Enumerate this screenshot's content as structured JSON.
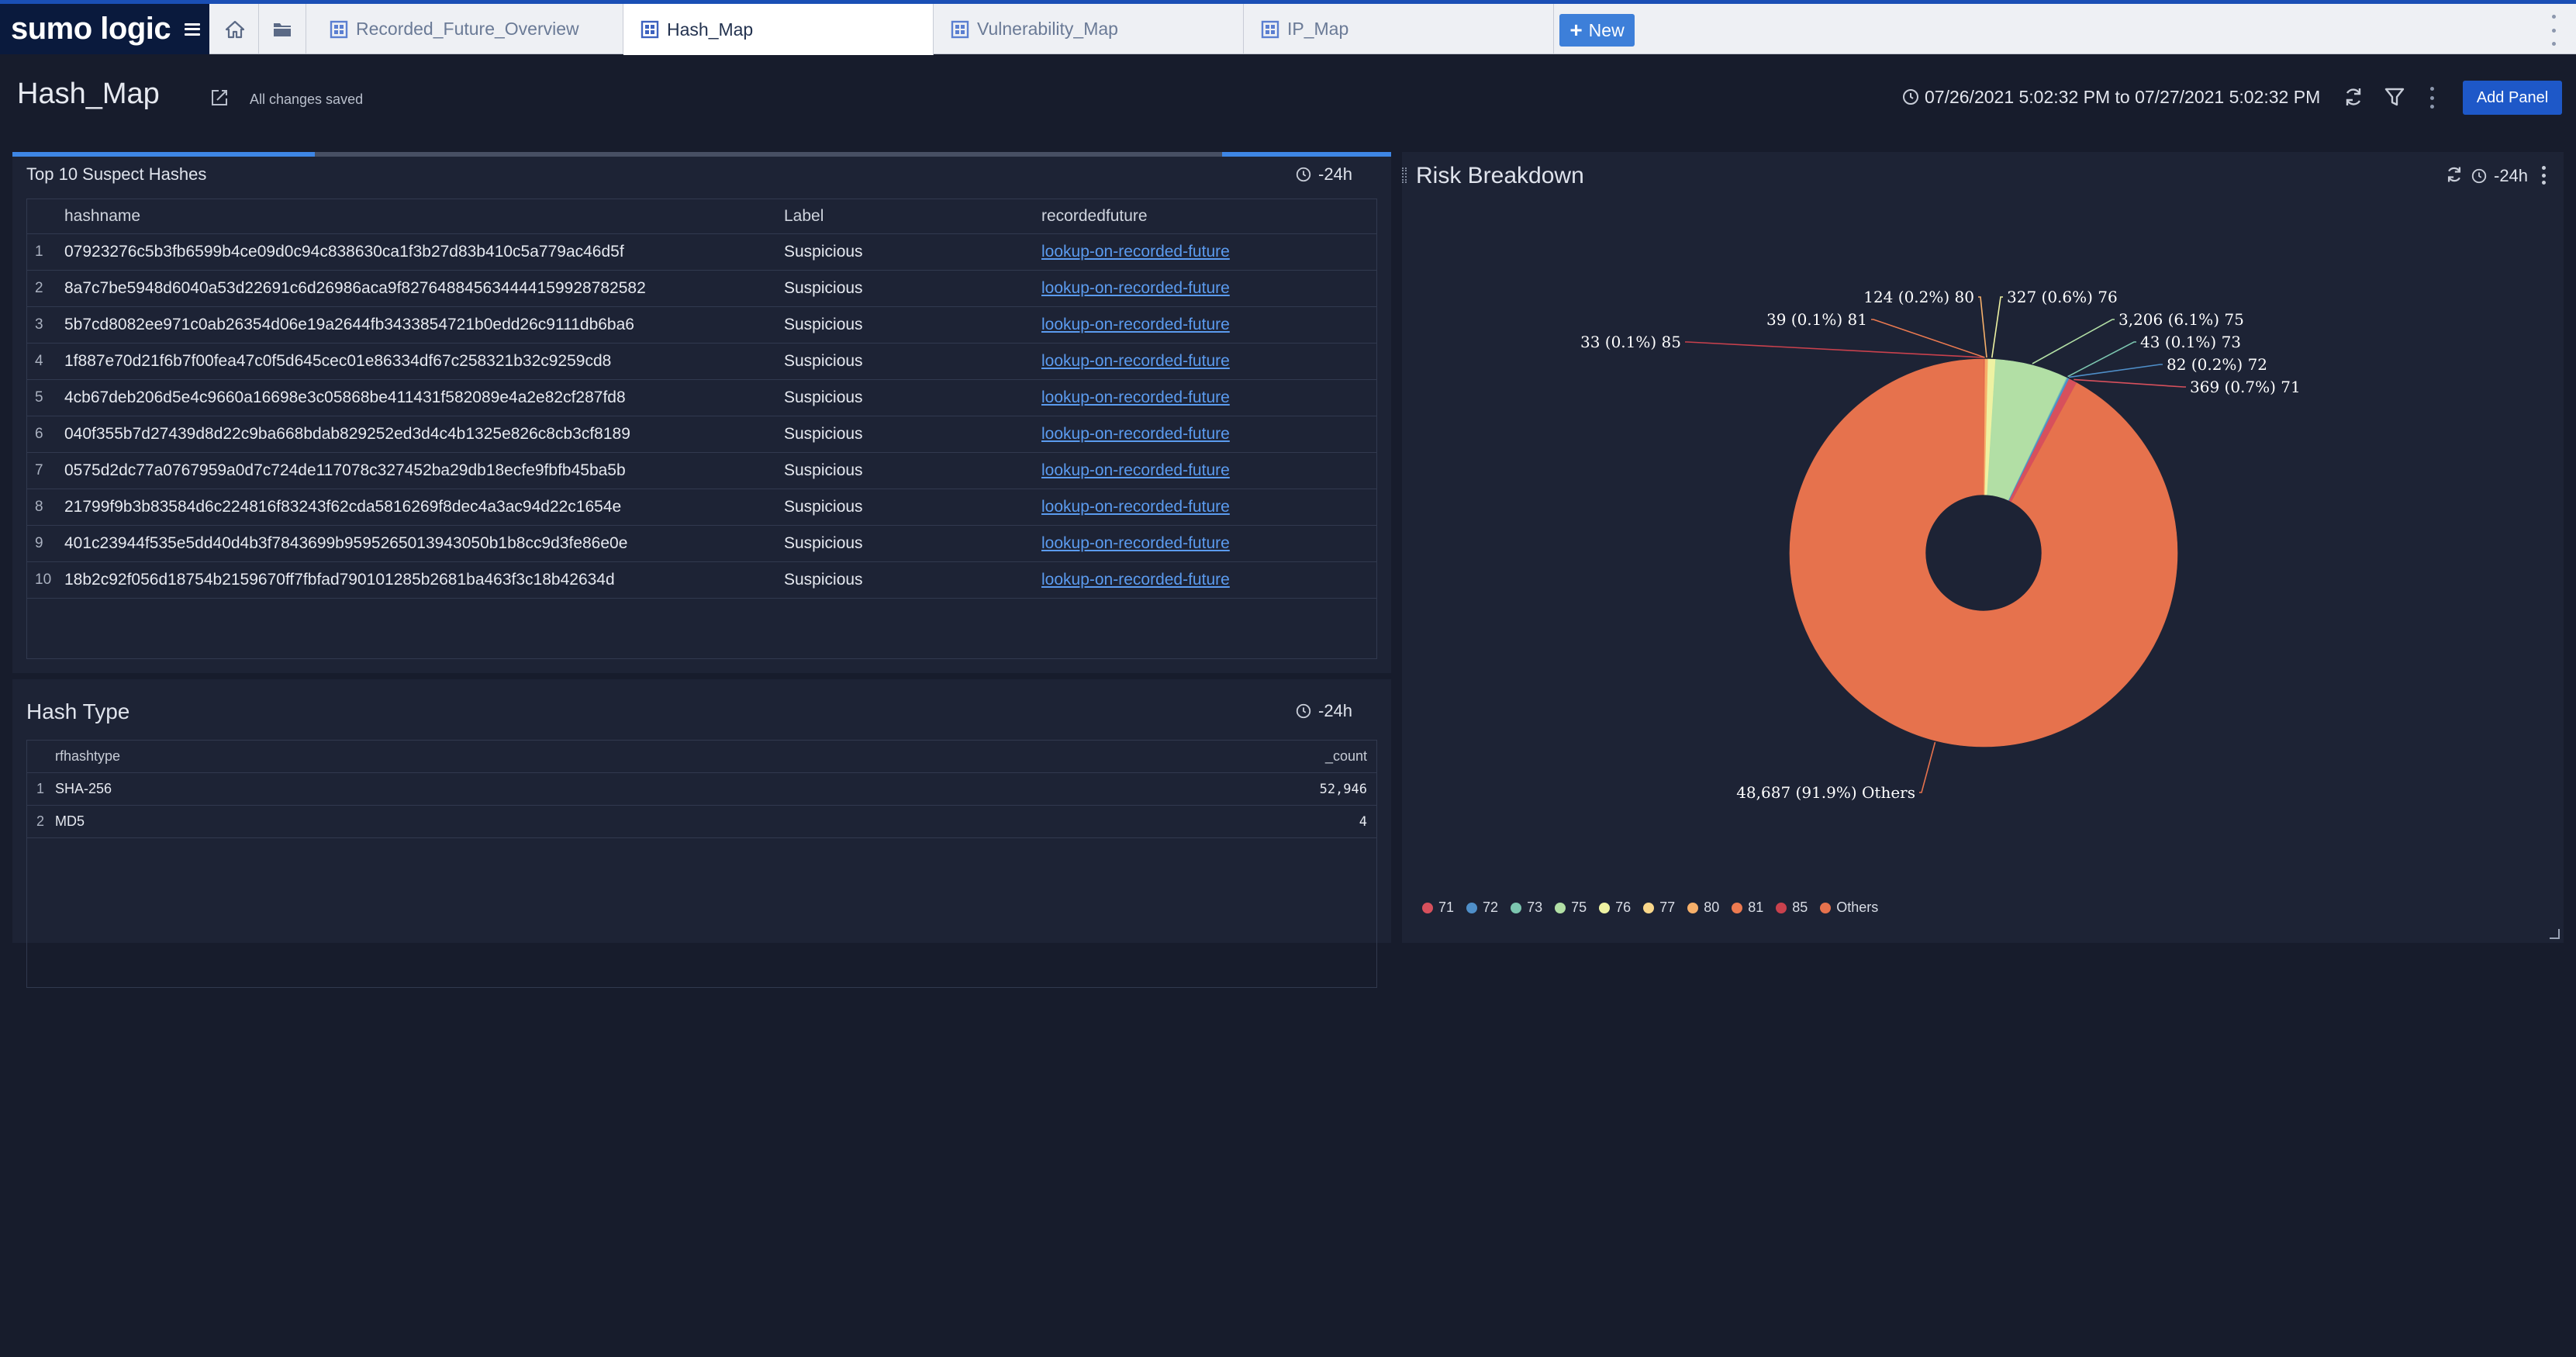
{
  "app": {
    "logo_text": "sumo logic"
  },
  "tabs": [
    {
      "label": "Recorded_Future_Overview",
      "active": false
    },
    {
      "label": "Hash_Map",
      "active": true
    },
    {
      "label": "Vulnerability_Map",
      "active": false
    },
    {
      "label": "IP_Map",
      "active": false
    }
  ],
  "new_button": {
    "label": "New"
  },
  "header": {
    "title": "Hash_Map",
    "save_status": "All changes saved",
    "time_range": "07/26/2021 5:02:32 PM to 07/27/2021 5:02:32 PM",
    "add_panel_label": "Add Panel"
  },
  "panels": {
    "suspect_hashes": {
      "title": "Top 10 Suspect Hashes",
      "time_range": "-24h",
      "columns": [
        "hashname",
        "Label",
        "recordedfuture"
      ],
      "rows": [
        {
          "n": "1",
          "hash": "07923276c5b3fb6599b4ce09d0c94c838630ca1f3b27d83b410c5a779ac46d5f",
          "label": "Suspicious",
          "link": "lookup-on-recorded-future"
        },
        {
          "n": "2",
          "hash": "8a7c7be5948d6040a53d22691c6d26986aca9f827648845634444159928782582",
          "label": "Suspicious",
          "link": "lookup-on-recorded-future"
        },
        {
          "n": "3",
          "hash": "5b7cd8082ee971c0ab26354d06e19a2644fb3433854721b0edd26c9111db6ba6",
          "label": "Suspicious",
          "link": "lookup-on-recorded-future"
        },
        {
          "n": "4",
          "hash": "1f887e70d21f6b7f00fea47c0f5d645cec01e86334df67c258321b32c9259cd8",
          "label": "Suspicious",
          "link": "lookup-on-recorded-future"
        },
        {
          "n": "5",
          "hash": "4cb67deb206d5e4c9660a16698e3c05868be411431f582089e4a2e82cf287fd8",
          "label": "Suspicious",
          "link": "lookup-on-recorded-future"
        },
        {
          "n": "6",
          "hash": "040f355b7d27439d8d22c9ba668bdab829252ed3d4c4b1325e826c8cb3cf8189",
          "label": "Suspicious",
          "link": "lookup-on-recorded-future"
        },
        {
          "n": "7",
          "hash": "0575d2dc77a0767959a0d7c724de117078c327452ba29db18ecfe9fbfb45ba5b",
          "label": "Suspicious",
          "link": "lookup-on-recorded-future"
        },
        {
          "n": "8",
          "hash": "21799f9b3b83584d6c224816f83243f62cda5816269f8dec4a3ac94d22c1654e",
          "label": "Suspicious",
          "link": "lookup-on-recorded-future"
        },
        {
          "n": "9",
          "hash": "401c23944f535e5dd40d4b3f7843699b9595265013943050b1b8cc9d3fe86e0e",
          "label": "Suspicious",
          "link": "lookup-on-recorded-future"
        },
        {
          "n": "10",
          "hash": "18b2c92f056d18754b2159670ff7fbfad790101285b2681ba463f3c18b42634d",
          "label": "Suspicious",
          "link": "lookup-on-recorded-future"
        }
      ]
    },
    "hash_type": {
      "title": "Hash Type",
      "time_range": "-24h",
      "columns": [
        "rfhashtype",
        "_count"
      ],
      "rows": [
        {
          "n": "1",
          "type": "SHA-256",
          "count": "52,946"
        },
        {
          "n": "2",
          "type": "MD5",
          "count": "4"
        }
      ]
    },
    "risk_breakdown": {
      "title": "Risk Breakdown",
      "time_range": "-24h"
    }
  },
  "chart_data": {
    "type": "pie",
    "title": "Risk Breakdown",
    "donut": true,
    "legend_position": "bottom-left",
    "slices": [
      {
        "name": "71",
        "value": 369,
        "label": "369 (0.7%) 71",
        "color": "#d7505c"
      },
      {
        "name": "72",
        "value": 82,
        "label": "82 (0.2%) 72",
        "color": "#4f8fc9"
      },
      {
        "name": "73",
        "value": 43,
        "label": "43 (0.1%) 73",
        "color": "#7cc6b0"
      },
      {
        "name": "75",
        "value": 3206,
        "label": "3,206 (6.1%) 75",
        "color": "#b2dfa5"
      },
      {
        "name": "76",
        "value": 327,
        "label": "327 (0.6%) 76",
        "color": "#eef2a2"
      },
      {
        "name": "77",
        "value": 0,
        "label": "",
        "color": "#f9d78a"
      },
      {
        "name": "80",
        "value": 124,
        "label": "124 (0.2%) 80",
        "color": "#f7b06a"
      },
      {
        "name": "81",
        "value": 39,
        "label": "39 (0.1%) 81",
        "color": "#ec7a50"
      },
      {
        "name": "85",
        "value": 33,
        "label": "33 (0.1%) 85",
        "color": "#c9414d"
      },
      {
        "name": "Others",
        "value": 48687,
        "label": "48,687 (91.9%) Others",
        "color": "#e6724d"
      }
    ]
  }
}
